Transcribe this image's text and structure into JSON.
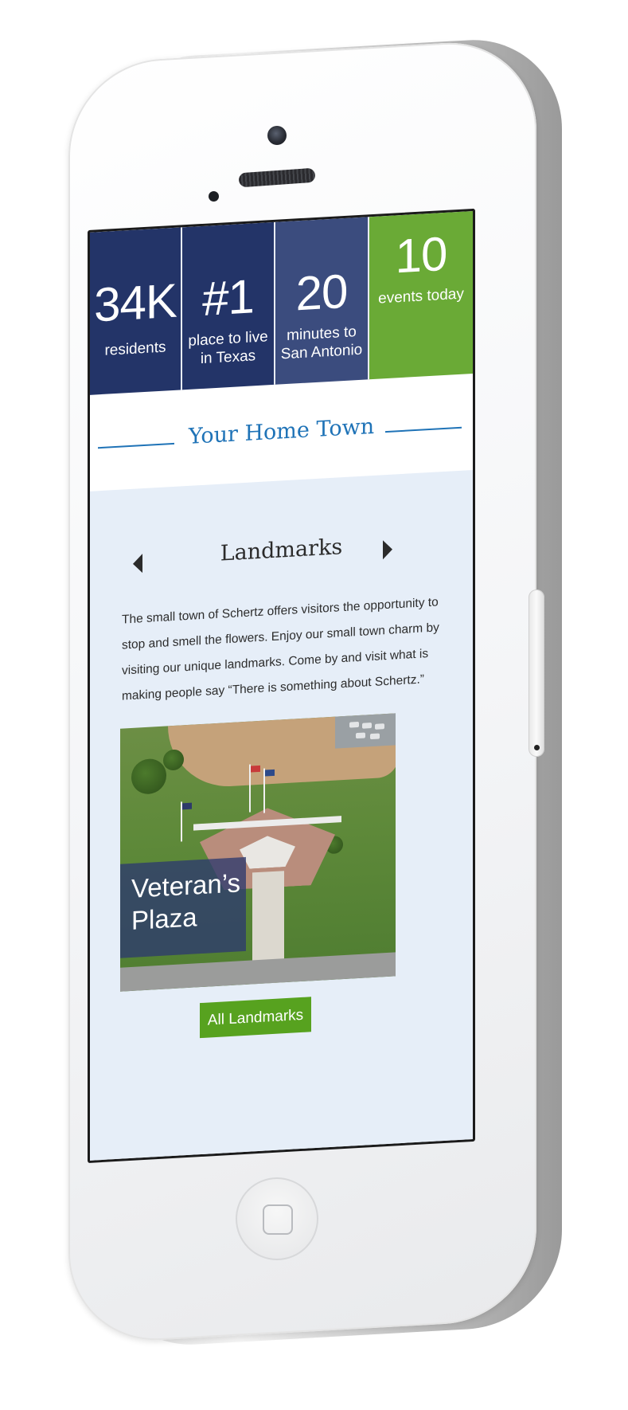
{
  "stats": [
    {
      "value": "34K",
      "label": "residents"
    },
    {
      "value": "#1",
      "label": "place to live in Texas"
    },
    {
      "value": "20",
      "label": "minutes to San Antonio"
    },
    {
      "value": "10",
      "label": "events today"
    }
  ],
  "home": {
    "title": "Your Home Town"
  },
  "landmarks": {
    "title": "Landmarks",
    "description": "The small town of Schertz offers visitors the opportunity to stop and smell the flowers. Enjoy our small town charm by visiting our unique landmarks. Come by and visit what is making people say “There is something about Schertz.”",
    "photo_caption": "Veteran’s Plaza",
    "button_label": "All Landmarks"
  },
  "colors": {
    "navy": "#233468",
    "slate": "#3b4c7e",
    "green": "#6aaa36",
    "button_green": "#57a21f",
    "link_blue": "#1f73b7",
    "panel_bg": "#e6eef8"
  },
  "icons": {
    "prev": "chevron-left-icon",
    "next": "chevron-right-icon",
    "home": "home-button-icon"
  }
}
